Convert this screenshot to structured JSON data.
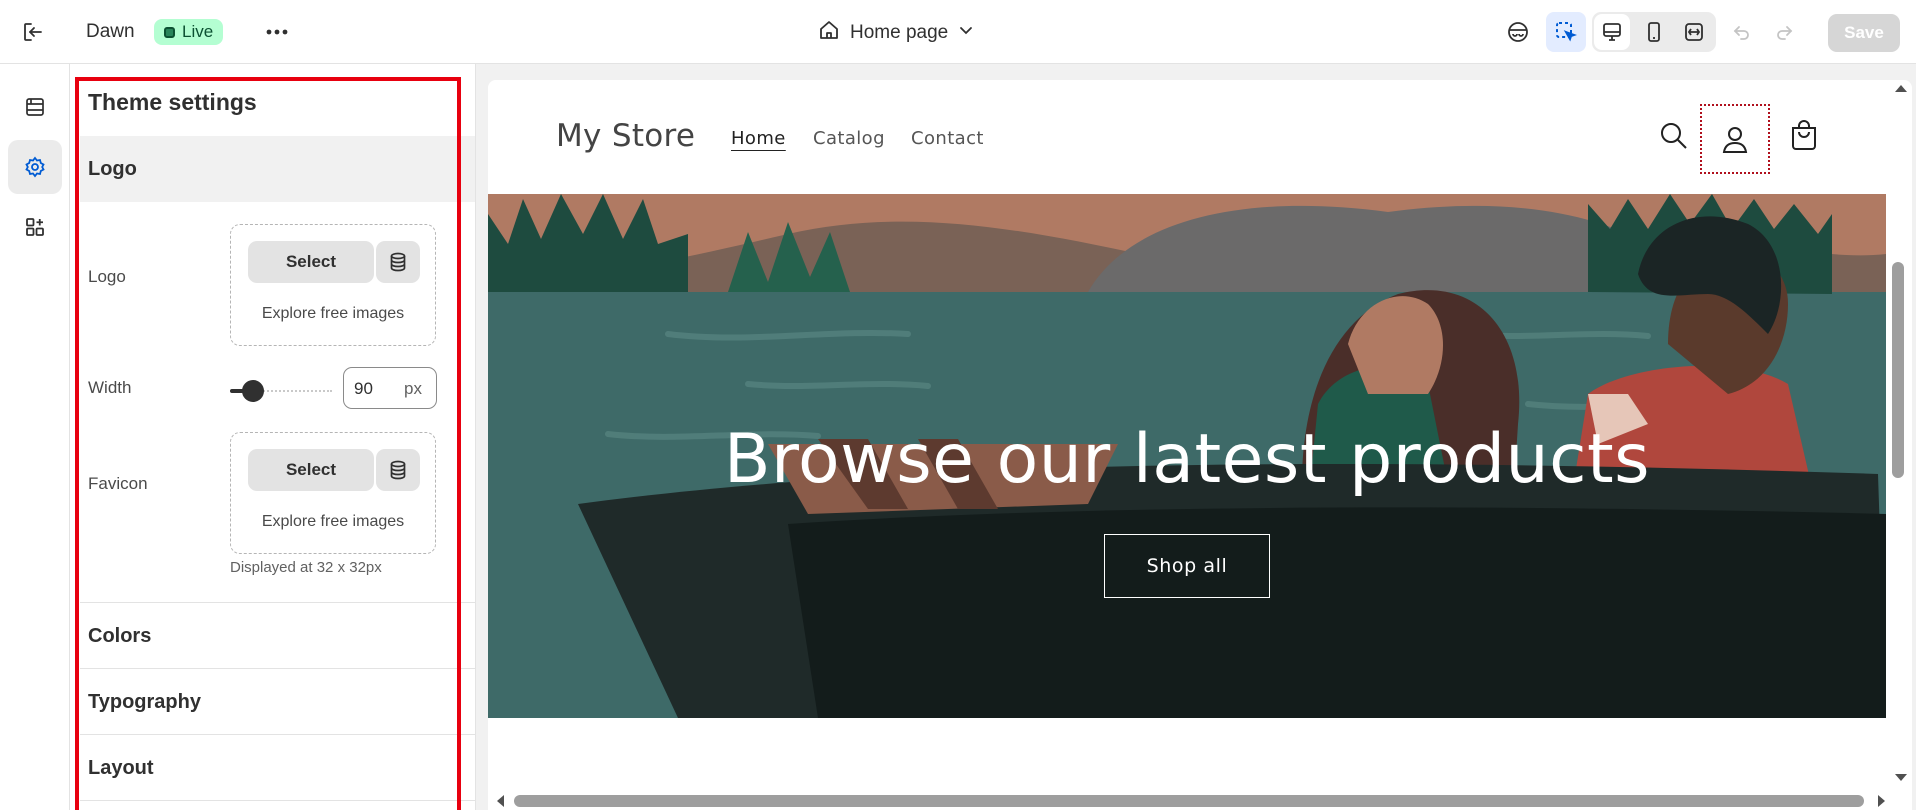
{
  "topbar": {
    "theme_name": "Dawn",
    "status_badge": "Live",
    "page_selector": "Home page",
    "save_label": "Save"
  },
  "icons": {
    "exit": "exit-icon",
    "more": "more-horizontal-icon",
    "home": "home-icon",
    "chevron": "chevron-down-icon",
    "inspector": "inspector-icon",
    "select_element": "select-element-icon",
    "desktop": "desktop-icon",
    "mobile": "mobile-icon",
    "fullscreen": "fullscreen-icon",
    "undo": "undo-icon",
    "redo": "redo-icon"
  },
  "rail": {
    "items": [
      "sections-icon",
      "settings-icon",
      "apps-icon"
    ],
    "active_index": 1
  },
  "panel": {
    "title": "Theme settings",
    "sections": [
      {
        "label": "Logo",
        "expanded": true
      },
      {
        "label": "Colors",
        "expanded": false
      },
      {
        "label": "Typography",
        "expanded": false
      },
      {
        "label": "Layout",
        "expanded": false
      }
    ],
    "logo_field": {
      "label": "Logo",
      "select_label": "Select",
      "explore_label": "Explore free images"
    },
    "width_field": {
      "label": "Width",
      "value": "90",
      "unit": "px",
      "slider_fraction": 0.22
    },
    "favicon_field": {
      "label": "Favicon",
      "select_label": "Select",
      "explore_label": "Explore free images",
      "hint": "Displayed at 32 x 32px"
    }
  },
  "preview": {
    "store_name": "My Store",
    "nav": [
      "Home",
      "Catalog",
      "Contact"
    ],
    "active_nav": "Home",
    "hero_title": "Browse our latest products",
    "hero_button": "Shop all"
  },
  "colors": {
    "live_badge_bg": "#b4fed2",
    "live_badge_text": "#0c5132",
    "highlight_outline": "#e8000f",
    "hero_water": "#3e6a68",
    "save_disabled_bg": "#d6d6d6"
  }
}
